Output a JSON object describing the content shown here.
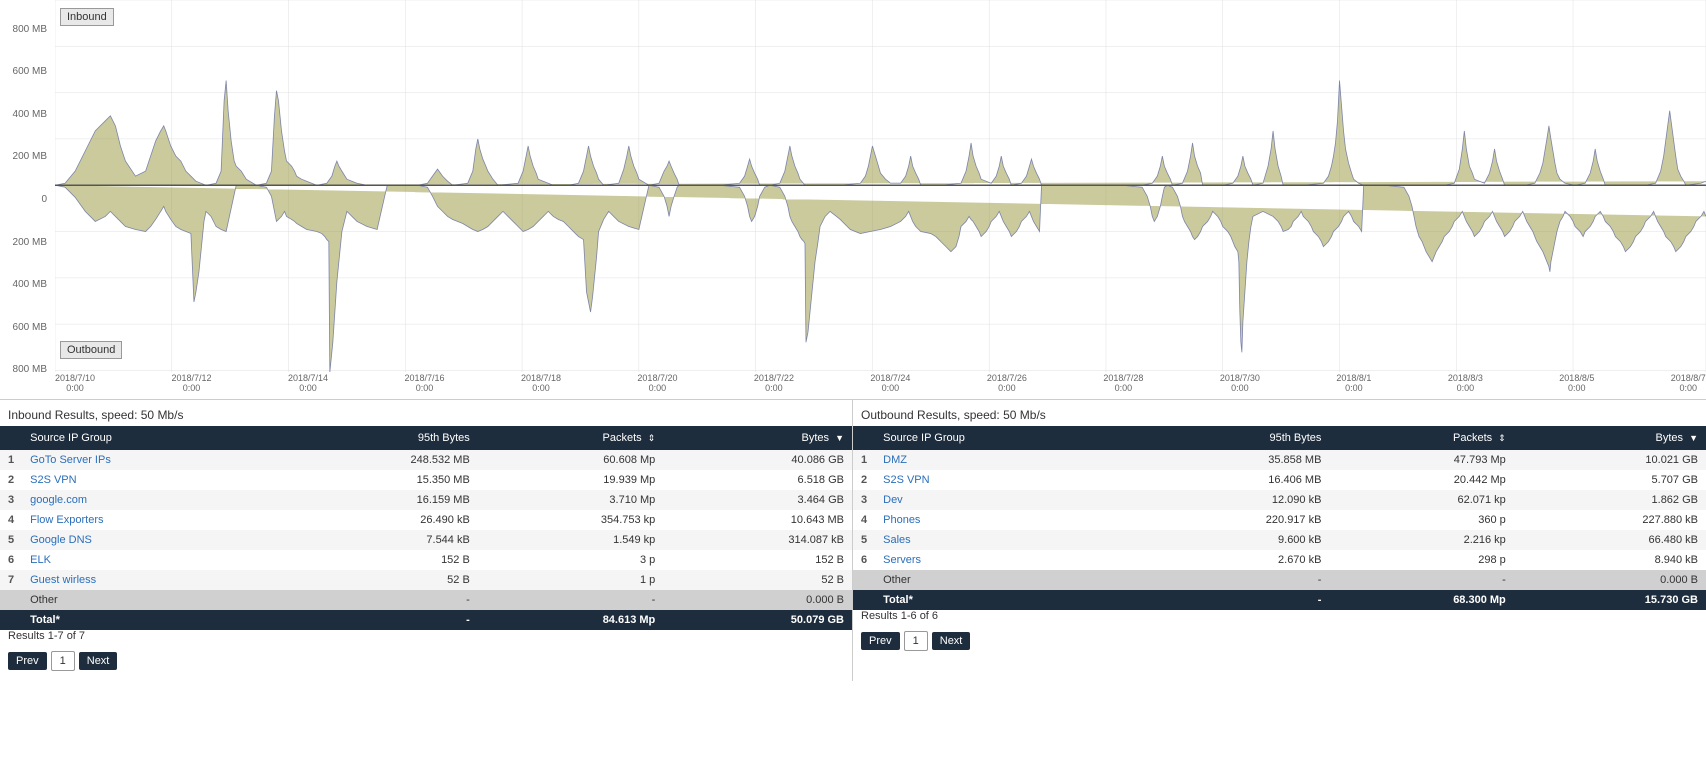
{
  "chart": {
    "inbound_label": "Inbound",
    "outbound_label": "Outbound",
    "y_labels_top": [
      "800 MB",
      "600 MB",
      "400 MB",
      "200 MB",
      "0"
    ],
    "y_labels_bottom": [
      "200 MB",
      "400 MB",
      "600 MB",
      "800 MB"
    ],
    "x_labels": [
      "2018/7/10\n0:00",
      "2018/7/12\n0:00",
      "2018/7/14\n0:00",
      "2018/7/16\n0:00",
      "2018/7/18\n0:00",
      "2018/7/20\n0:00",
      "2018/7/22\n0:00",
      "2018/7/24\n0:00",
      "2018/7/26\n0:00",
      "2018/7/28\n0:00",
      "2018/7/30\n0:00",
      "2018/8/1\n0:00",
      "2018/8/3\n0:00",
      "2018/8/5\n0:00",
      "2018/8/7\n0:00"
    ]
  },
  "inbound": {
    "title": "Inbound Results, speed: 50 Mb/s",
    "columns": {
      "group": "Source IP Group",
      "bytes95": "95th Bytes",
      "packets": "Packets",
      "bytes": "Bytes"
    },
    "rows": [
      {
        "num": 1,
        "group": "GoTo Server IPs",
        "bytes95": "248.532 MB",
        "packets": "60.608 Mp",
        "bytes": "40.086 GB"
      },
      {
        "num": 2,
        "group": "S2S VPN",
        "bytes95": "15.350 MB",
        "packets": "19.939 Mp",
        "bytes": "6.518 GB"
      },
      {
        "num": 3,
        "group": "google.com",
        "bytes95": "16.159 MB",
        "packets": "3.710 Mp",
        "bytes": "3.464 GB"
      },
      {
        "num": 4,
        "group": "Flow Exporters",
        "bytes95": "26.490 kB",
        "packets": "354.753 kp",
        "bytes": "10.643 MB"
      },
      {
        "num": 5,
        "group": "Google DNS",
        "bytes95": "7.544 kB",
        "packets": "1.549 kp",
        "bytes": "314.087 kB"
      },
      {
        "num": 6,
        "group": "ELK",
        "bytes95": "152 B",
        "packets": "3 p",
        "bytes": "152 B"
      },
      {
        "num": 7,
        "group": "Guest wirless",
        "bytes95": "52 B",
        "packets": "1 p",
        "bytes": "52 B"
      }
    ],
    "other_row": {
      "group": "Other",
      "bytes95": "-",
      "packets": "-",
      "bytes": "0.000 B"
    },
    "total_row": {
      "group": "Total*",
      "bytes95": "-",
      "packets": "84.613 Mp",
      "bytes": "50.079 GB"
    },
    "pagination": {
      "info": "Results 1-7 of 7",
      "prev": "Prev",
      "page1": "1",
      "next": "Next"
    }
  },
  "outbound": {
    "title": "Outbound Results, speed: 50 Mb/s",
    "columns": {
      "group": "Source IP Group",
      "bytes95": "95th Bytes",
      "packets": "Packets",
      "bytes": "Bytes"
    },
    "rows": [
      {
        "num": 1,
        "group": "DMZ",
        "bytes95": "35.858 MB",
        "packets": "47.793 Mp",
        "bytes": "10.021 GB"
      },
      {
        "num": 2,
        "group": "S2S VPN",
        "bytes95": "16.406 MB",
        "packets": "20.442 Mp",
        "bytes": "5.707 GB"
      },
      {
        "num": 3,
        "group": "Dev",
        "bytes95": "12.090 kB",
        "packets": "62.071 kp",
        "bytes": "1.862 GB"
      },
      {
        "num": 4,
        "group": "Phones",
        "bytes95": "220.917 kB",
        "packets": "360 p",
        "bytes": "227.880 kB"
      },
      {
        "num": 5,
        "group": "Sales",
        "bytes95": "9.600 kB",
        "packets": "2.216 kp",
        "bytes": "66.480 kB"
      },
      {
        "num": 6,
        "group": "Servers",
        "bytes95": "2.670 kB",
        "packets": "298 p",
        "bytes": "8.940 kB"
      }
    ],
    "other_row": {
      "group": "Other",
      "bytes95": "-",
      "packets": "-",
      "bytes": "0.000 B"
    },
    "total_row": {
      "group": "Total*",
      "bytes95": "-",
      "packets": "68.300 Mp",
      "bytes": "15.730 GB"
    },
    "pagination": {
      "info": "Results 1-6 of 6",
      "prev": "Prev",
      "page1": "1",
      "next": "Next"
    }
  }
}
